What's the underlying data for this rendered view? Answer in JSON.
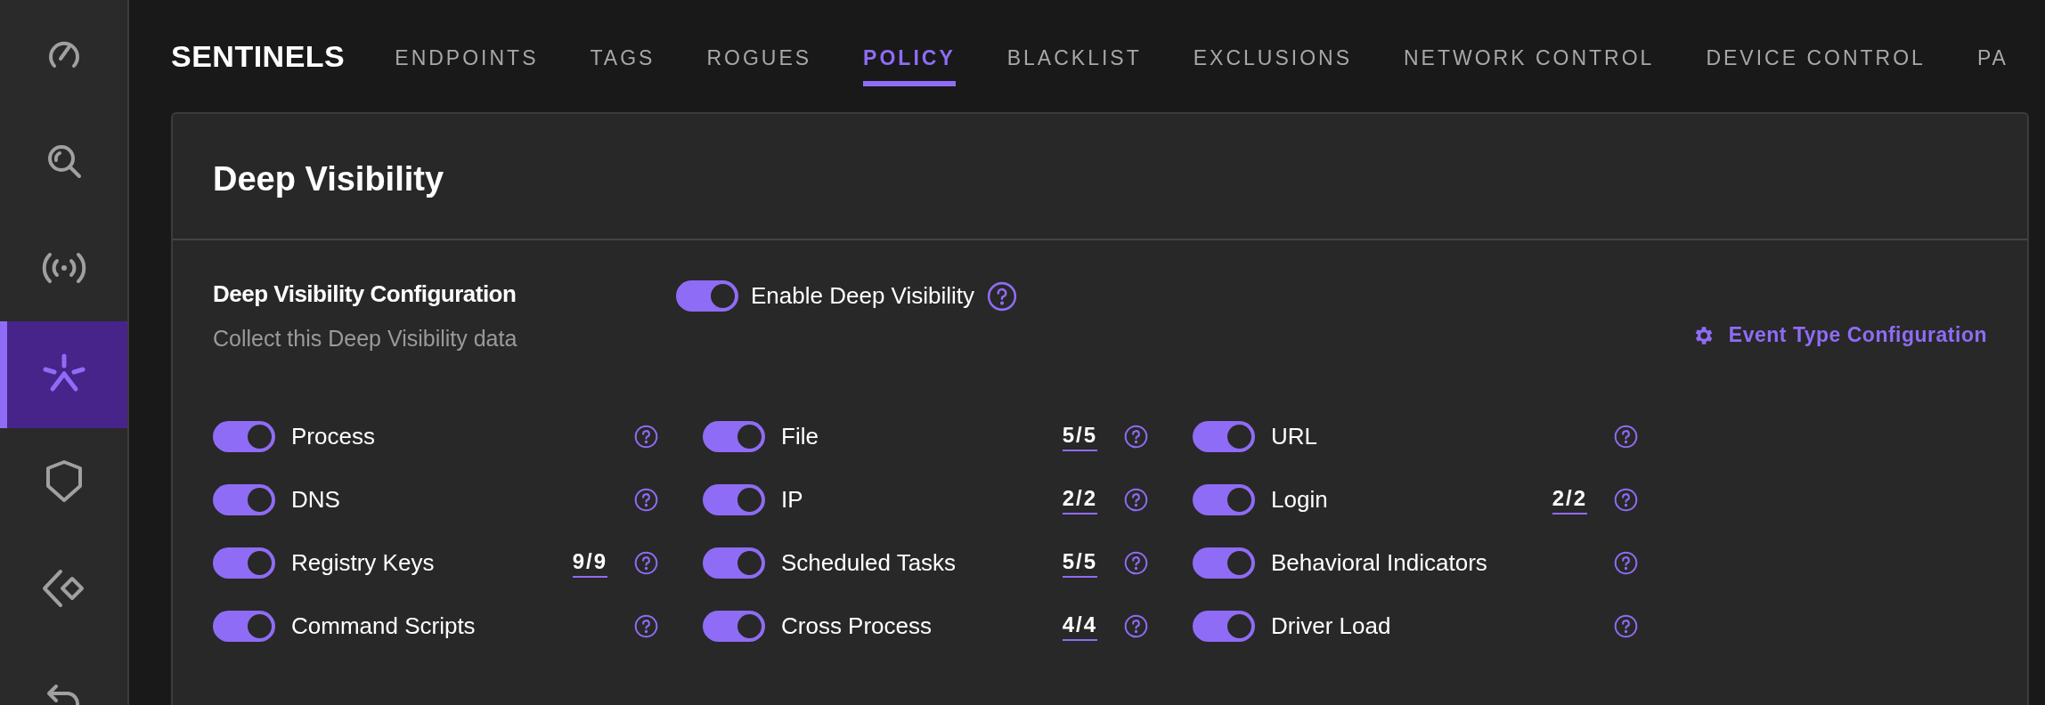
{
  "sidebar": {
    "items": [
      {
        "kind": "gauge",
        "selected": false
      },
      {
        "kind": "search",
        "selected": false
      },
      {
        "kind": "broadcast",
        "selected": false
      },
      {
        "kind": "asterisk",
        "selected": true
      },
      {
        "kind": "shield",
        "selected": false
      },
      {
        "kind": "diamond",
        "selected": false
      },
      {
        "kind": "undo",
        "selected": false
      }
    ]
  },
  "header": {
    "title": "SENTINELS",
    "tabs": [
      {
        "label": "ENDPOINTS",
        "selected": false
      },
      {
        "label": "TAGS",
        "selected": false
      },
      {
        "label": "ROGUES",
        "selected": false
      },
      {
        "label": "POLICY",
        "selected": true
      },
      {
        "label": "BLACKLIST",
        "selected": false
      },
      {
        "label": "EXCLUSIONS",
        "selected": false
      },
      {
        "label": "NETWORK CONTROL",
        "selected": false
      },
      {
        "label": "DEVICE CONTROL",
        "selected": false
      },
      {
        "label": "PA",
        "selected": false
      }
    ]
  },
  "panel": {
    "title": "Deep Visibility",
    "config_title": "Deep Visibility Configuration",
    "config_subtitle": "Collect this Deep Visibility data",
    "enable": {
      "label": "Enable Deep Visibility",
      "on": true
    },
    "event_link": "Event Type Configuration",
    "columns": [
      [
        {
          "label": "Process",
          "on": true
        },
        {
          "label": "DNS",
          "on": true
        },
        {
          "label": "Registry Keys",
          "on": true,
          "count": "9/9"
        },
        {
          "label": "Command Scripts",
          "on": true
        }
      ],
      [
        {
          "label": "File",
          "on": true,
          "count": "5/5"
        },
        {
          "label": "IP",
          "on": true,
          "count": "2/2"
        },
        {
          "label": "Scheduled Tasks",
          "on": true,
          "count": "5/5"
        },
        {
          "label": "Cross Process",
          "on": true,
          "count": "4/4"
        }
      ],
      [
        {
          "label": "URL",
          "on": true
        },
        {
          "label": "Login",
          "on": true,
          "count": "2/2"
        },
        {
          "label": "Behavioral Indicators",
          "on": true
        },
        {
          "label": "Driver Load",
          "on": true
        }
      ]
    ]
  }
}
